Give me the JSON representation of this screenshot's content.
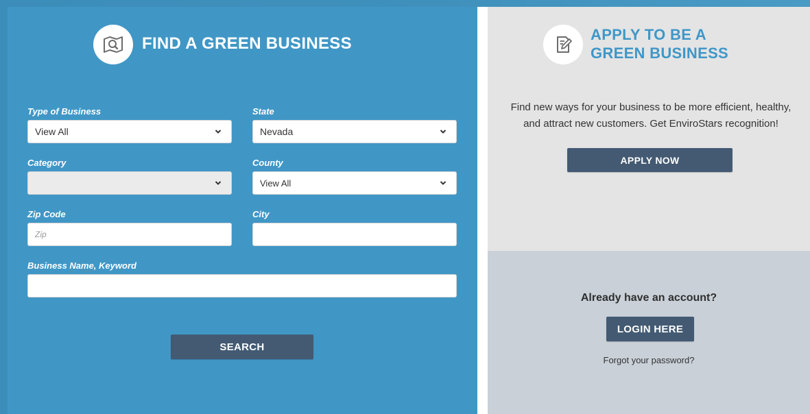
{
  "find": {
    "title": "FIND A GREEN BUSINESS",
    "type_label": "Type of Business",
    "type_value": "View All",
    "state_label": "State",
    "state_value": "Nevada",
    "category_label": "Category",
    "category_value": "",
    "county_label": "County",
    "county_value": "View All",
    "zip_label": "Zip Code",
    "zip_placeholder": "Zip",
    "city_label": "City",
    "keyword_label": "Business Name, Keyword",
    "search_label": "SEARCH"
  },
  "apply": {
    "title_line1": "APPLY TO BE A",
    "title_line2": "GREEN BUSINESS",
    "description": "Find new ways for your business to be more efficient, healthy, and attract new customers. Get EnviroStars recognition!",
    "button_label": "APPLY NOW"
  },
  "account": {
    "prompt": "Already have an account?",
    "login_label": "LOGIN HERE",
    "forgot_label": "Forgot your password?"
  },
  "icons": {
    "find": "map-search-icon",
    "apply": "edit-document-icon",
    "dropdown": "chevron-down-icon"
  },
  "colors": {
    "left_panel": "#4097c6",
    "button": "#435a72",
    "apply_title": "#3f97c8",
    "right_top": "#e4e4e4",
    "right_bottom": "#c9d0d8"
  }
}
